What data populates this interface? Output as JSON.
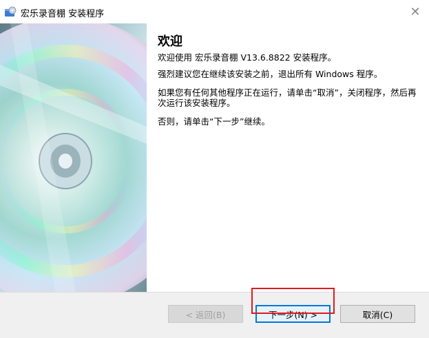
{
  "window": {
    "title": "宏乐录音棚 安装程序",
    "close_glyph": "✕"
  },
  "welcome": {
    "heading": "欢迎",
    "line1": "欢迎使用 宏乐录音棚 V13.6.8822 安装程序。",
    "line2": "强烈建议您在继续该安装之前，退出所有 Windows 程序。",
    "line3": "如果您有任何其他程序正在运行，请单击“取消”，关闭程序，然后再次运行该安装程序。",
    "line4": "否则，请单击“下一步”继续。"
  },
  "buttons": {
    "back_label": "< 返回(B)",
    "next_label": "下一步(N) >",
    "cancel_label": "取消(C)"
  },
  "icons": {
    "app": "installer-disc-icon",
    "close": "close-icon",
    "banner": "cd-disc-image"
  },
  "colors": {
    "highlight": "#e0191a",
    "focus_border": "#0078d7"
  }
}
